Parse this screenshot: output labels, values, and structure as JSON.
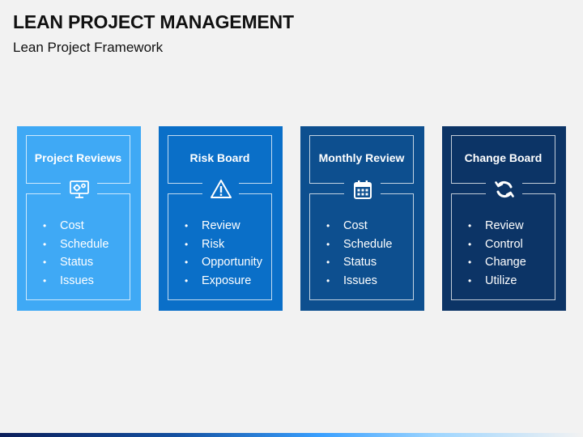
{
  "slide": {
    "title": "LEAN PROJECT MANAGEMENT",
    "subtitle": "Lean Project Framework"
  },
  "cards": [
    {
      "title": "Project Reviews",
      "icon": "monitor-gear-icon",
      "color": "#3fa9f5",
      "items": [
        "Cost",
        "Schedule",
        "Status",
        "Issues"
      ]
    },
    {
      "title": "Risk Board",
      "icon": "warning-icon",
      "color": "#0a6fc8",
      "items": [
        "Review",
        "Risk",
        "Opportunity",
        "Exposure"
      ]
    },
    {
      "title": "Monthly Review",
      "icon": "calendar-icon",
      "color": "#0d4f8f",
      "items": [
        "Cost",
        "Schedule",
        "Status",
        "Issues"
      ]
    },
    {
      "title": "Change Board",
      "icon": "refresh-icon",
      "color": "#0c3466",
      "items": [
        "Review",
        "Control",
        "Change",
        "Utilize"
      ]
    }
  ],
  "bullet_glyph": "•"
}
